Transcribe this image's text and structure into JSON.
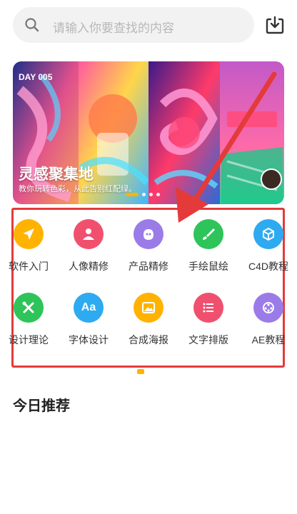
{
  "search": {
    "placeholder": "请输入你要查找的内容"
  },
  "banner": {
    "title": "灵感聚集地",
    "subtitle": "教你玩转色彩，从此告别红配绿。",
    "top_label": "DAY 005",
    "slide_count": 5,
    "active_slide": 1
  },
  "categories": [
    {
      "label": "软件入门",
      "icon": "send-icon",
      "color": "#ffb300"
    },
    {
      "label": "人像精修",
      "icon": "person-icon",
      "color": "#f0506e"
    },
    {
      "label": "产品精修",
      "icon": "product-icon",
      "color": "#9b7be8"
    },
    {
      "label": "手绘鼠绘",
      "icon": "brush-icon",
      "color": "#2ec45a"
    },
    {
      "label": "C4D教程",
      "icon": "cube-icon",
      "color": "#2eaaf0"
    },
    {
      "label": "设计理论",
      "icon": "tools-icon",
      "color": "#2ec45a"
    },
    {
      "label": "字体设计",
      "icon": "font-icon",
      "color": "#2eaaf0"
    },
    {
      "label": "合成海报",
      "icon": "image-icon",
      "color": "#ffb300"
    },
    {
      "label": "文字排版",
      "icon": "list-icon",
      "color": "#f0506e"
    },
    {
      "label": "AE教程",
      "icon": "film-icon",
      "color": "#9b7be8"
    }
  ],
  "section": {
    "today_title": "今日推荐"
  },
  "colors": {
    "accent": "#ffb300",
    "annotation": "#e43a3a"
  }
}
